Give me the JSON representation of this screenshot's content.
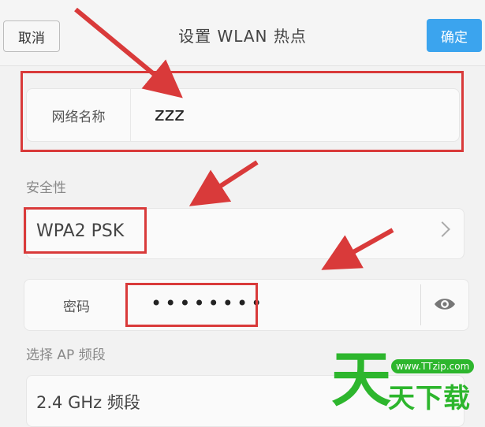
{
  "header": {
    "cancel_label": "取消",
    "title": "设置 WLAN 热点",
    "confirm_label": "确定"
  },
  "network_name": {
    "label": "网络名称",
    "value": "zzz"
  },
  "security": {
    "section_label": "安全性",
    "value": "WPA2 PSK"
  },
  "password": {
    "label": "密码",
    "value": "••••••••",
    "toggle_icon": "eye-icon"
  },
  "band": {
    "section_label": "选择 AP 频段",
    "value": "2.4 GHz 频段"
  },
  "watermark": {
    "big_char": "天",
    "url": "www.TTzip.com",
    "text": "天下载"
  },
  "colors": {
    "accent": "#3ba4ee",
    "highlight": "#d93a3a",
    "watermark": "#2db62d"
  }
}
